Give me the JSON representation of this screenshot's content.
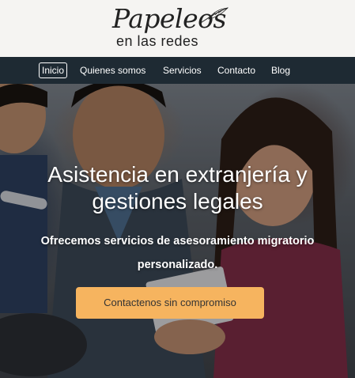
{
  "logo": {
    "script_text": "Papeleos",
    "sub_text": "en las redes"
  },
  "nav": {
    "items": [
      {
        "label": "Inicio",
        "active": true
      },
      {
        "label": "Quienes somos",
        "active": false
      },
      {
        "label": "Servicios",
        "active": false
      },
      {
        "label": "Contacto",
        "active": false
      },
      {
        "label": "Blog",
        "active": false
      }
    ]
  },
  "hero": {
    "title_line1": "Asistencia en extranjería y",
    "title_line2": "gestiones legales",
    "subtitle_line1": "Ofrecemos servicios de asesoramiento migratorio",
    "subtitle_line2": "personalizado.",
    "cta_label": "Contactenos sin compromiso"
  },
  "colors": {
    "nav_bg": "#1e2a33",
    "cta_bg": "#f6b45f",
    "header_bg": "#f5f4f2"
  }
}
